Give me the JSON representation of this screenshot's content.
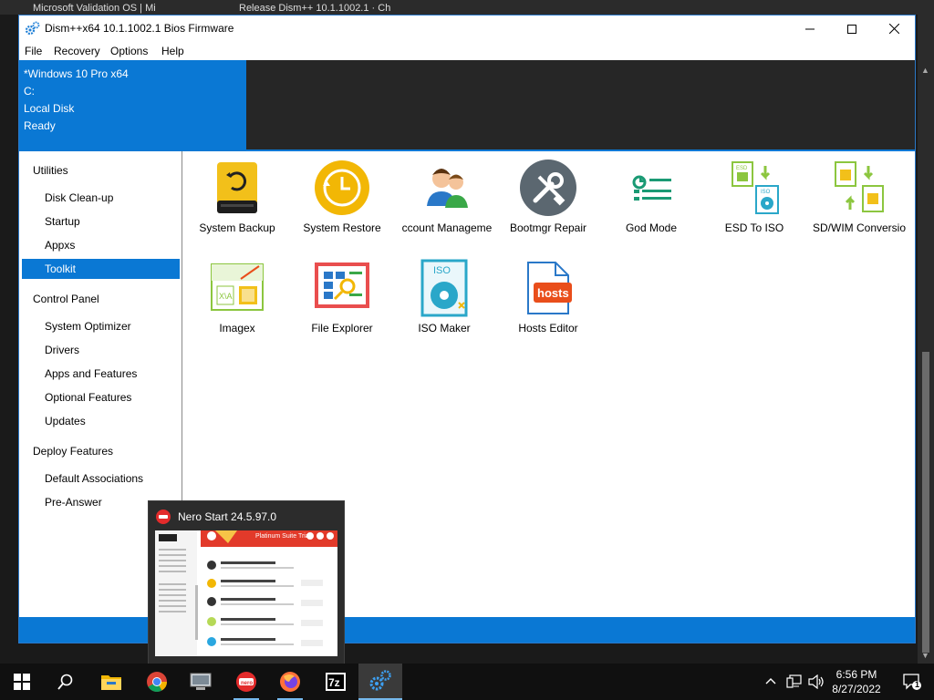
{
  "window": {
    "title": "Dism++x64 10.1.1002.1 Bios Firmware",
    "menu": [
      "File",
      "Recovery",
      "Options",
      "Help"
    ]
  },
  "info": {
    "os": "*Windows 10 Pro x64",
    "drive": "C:",
    "disk": "Local Disk",
    "status": "Ready"
  },
  "sidebar": {
    "sections": [
      {
        "label": "Utilities",
        "items": [
          "Disk Clean-up",
          "Startup",
          "Appxs",
          "Toolkit"
        ]
      },
      {
        "label": "Control Panel",
        "items": [
          "System Optimizer",
          "Drivers",
          "Apps and Features",
          "Optional Features",
          "Updates"
        ]
      },
      {
        "label": "Deploy Features",
        "items": [
          "Default Associations",
          "Pre-Answer"
        ]
      }
    ],
    "selected": "Toolkit"
  },
  "tools": [
    {
      "label": "System Backup",
      "icon": "system-backup-icon"
    },
    {
      "label": "System Restore",
      "icon": "system-restore-icon"
    },
    {
      "label": "ccount Manageme",
      "icon": "account-management-icon"
    },
    {
      "label": "Bootmgr Repair",
      "icon": "bootmgr-repair-icon"
    },
    {
      "label": "God Mode",
      "icon": "god-mode-icon"
    },
    {
      "label": "ESD To ISO",
      "icon": "esd-to-iso-icon"
    },
    {
      "label": "SD/WIM Conversio",
      "icon": "esd-wim-conversion-icon"
    },
    {
      "label": "Imagex",
      "icon": "imagex-icon"
    },
    {
      "label": "File Explorer",
      "icon": "file-explorer-icon"
    },
    {
      "label": "ISO Maker",
      "icon": "iso-maker-icon"
    },
    {
      "label": "Hosts Editor",
      "icon": "hosts-editor-icon"
    }
  ],
  "thumbnail": {
    "title": "Nero Start 24.5.97.0",
    "banner": "Platinum Suite Trial"
  },
  "taskbar": {
    "apps": [
      "start-icon",
      "search-icon",
      "file-explorer-icon",
      "chrome-icon",
      "computer-icon",
      "nero-icon",
      "firefox-icon",
      "7zip-icon",
      "dism-icon"
    ],
    "time": "6:56 PM",
    "date": "8/27/2022",
    "notification_count": "1"
  },
  "colors": {
    "accent": "#0a78d4",
    "dark": "#262626",
    "taskbar": "#101010"
  }
}
